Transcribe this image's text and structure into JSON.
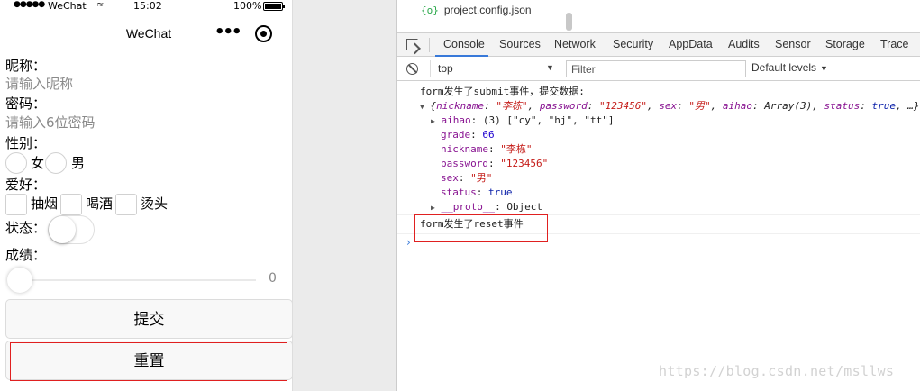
{
  "status_bar": {
    "signal": "●●●●●",
    "carrier": "WeChat",
    "wifi": "≈",
    "time": "15:02",
    "battery": "100%"
  },
  "nav": {
    "title": "WeChat",
    "more": "•••"
  },
  "form": {
    "nickname_label": "昵称：",
    "nickname_placeholder": "请输入昵称",
    "password_label": "密码：",
    "password_placeholder": "请输入6位密码",
    "gender_label": "性别：",
    "gender_options": [
      "女",
      "男"
    ],
    "hobby_label": "爱好：",
    "hobby_options": [
      "抽烟",
      "喝酒",
      "烫头"
    ],
    "status_label": "状态：",
    "status_on": false,
    "grade_label": "成绩：",
    "grade_value": "0",
    "submit_label": "提交",
    "reset_label": "重置"
  },
  "devtools": {
    "file_tab": {
      "icon": "{o}",
      "name": "project.config.json"
    },
    "tabs": [
      "Console",
      "Sources",
      "Network",
      "Security",
      "AppData",
      "Audits",
      "Sensor",
      "Storage",
      "Trace"
    ],
    "active_tab": "Console",
    "context": "top",
    "filter_placeholder": "Filter",
    "levels": "Default levels",
    "accent_color": "#3879d9",
    "highlight_color": "#e02020"
  },
  "console": {
    "submit_msg": "form发生了submit事件，提交数据:",
    "summary": {
      "open": "{",
      "k_nickname": "nickname",
      "v_nickname": "\"李栋\"",
      "k_password": "password",
      "v_password": "\"123456\"",
      "k_sex": "sex",
      "v_sex": "\"男\"",
      "k_aihao": "aihao",
      "v_aihao": "Array(3)",
      "k_status": "status",
      "v_status": "true",
      "tail": "…}"
    },
    "aihao_key": "aihao",
    "aihao_count": "(3)",
    "aihao_items": "[\"cy\", \"hj\", \"tt\"]",
    "grade_key": "grade",
    "grade_val": "66",
    "nickname_key": "nickname",
    "nickname_val": "\"李栋\"",
    "password_key": "password",
    "password_val": "\"123456\"",
    "sex_key": "sex",
    "sex_val": "\"男\"",
    "status_key": "status",
    "status_val": "true",
    "proto_key": "__proto__",
    "proto_val": "Object",
    "reset_msg": "form发生了reset事件",
    "prompt": "›"
  },
  "watermark": "https://blog.csdn.net/msllws"
}
